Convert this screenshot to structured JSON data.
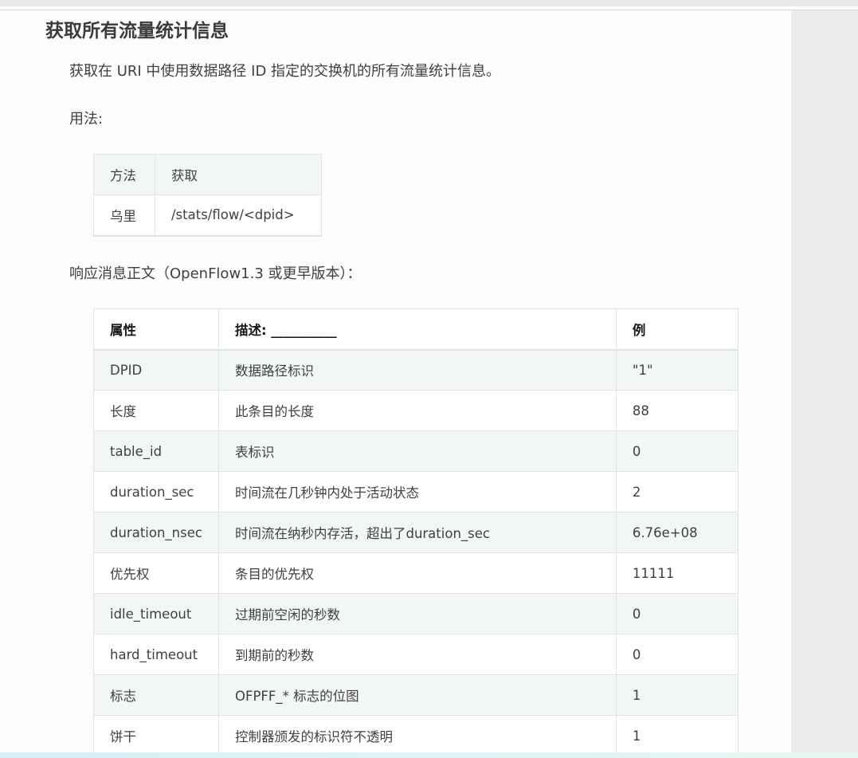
{
  "heading": "获取所有流量统计信息",
  "description": "获取在 URI 中使用数据路径 ID 指定的交换机的所有流量统计信息。",
  "usage_label": "用法:",
  "usage_table": [
    {
      "key": "方法",
      "value": "获取"
    },
    {
      "key": "乌里",
      "value": "/stats/flow/<dpid>"
    }
  ],
  "response_label": "响应消息正文（OpenFlow1.3 或更早版本）：",
  "response_table": {
    "headers": [
      "属性",
      "描述: __________",
      "例"
    ],
    "rows": [
      [
        "DPID",
        "数据路径标识",
        "\"1\""
      ],
      [
        "长度",
        "此条目的长度",
        "88"
      ],
      [
        "table_id",
        "表标识",
        "0"
      ],
      [
        "duration_sec",
        "时间流在几秒钟内处于活动状态",
        "2"
      ],
      [
        "duration_nsec",
        "时间流在纳秒内存活，超出了duration_sec",
        "6.76e+08"
      ],
      [
        "优先权",
        "条目的优先权",
        "11111"
      ],
      [
        "idle_timeout",
        "过期前空闲的秒数",
        "0"
      ],
      [
        "hard_timeout",
        "到期前的秒数",
        "0"
      ],
      [
        "标志",
        "OFPFF_* 标志的位图",
        "1"
      ],
      [
        "饼干",
        "控制器颁发的标识符不透明",
        "1"
      ]
    ]
  }
}
